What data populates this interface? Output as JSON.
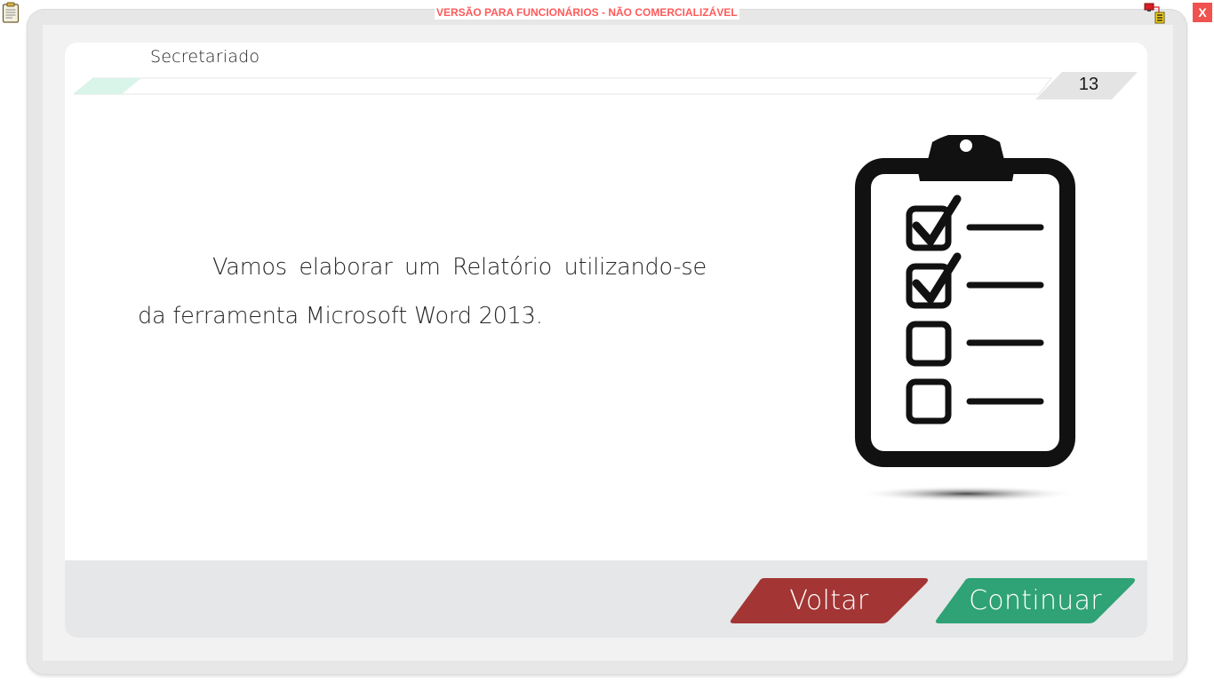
{
  "window": {
    "watermark": "VERSÃO PARA FUNCIONÁRIOS - NÃO COMERCIALIZÁVEL",
    "close_label": "X",
    "app_icon": "clipboard-icon",
    "network_icon": "network-computer-icon"
  },
  "header": {
    "section_title": "Secretariado",
    "page_number": "13"
  },
  "content": {
    "paragraph": "Vamos elaborar um  Relatório utilizando-se da ferramenta Microsoft Word 2013.",
    "illustration": "checklist-clipboard-icon"
  },
  "navigation": {
    "back_label": "Voltar",
    "continue_label": "Continuar"
  },
  "colors": {
    "back_button": "#a33535",
    "continue_button": "#2fa276",
    "watermark_text": "#ff5a5a",
    "close_button": "#f0524f",
    "progress_accent": "#d9f5ea"
  }
}
